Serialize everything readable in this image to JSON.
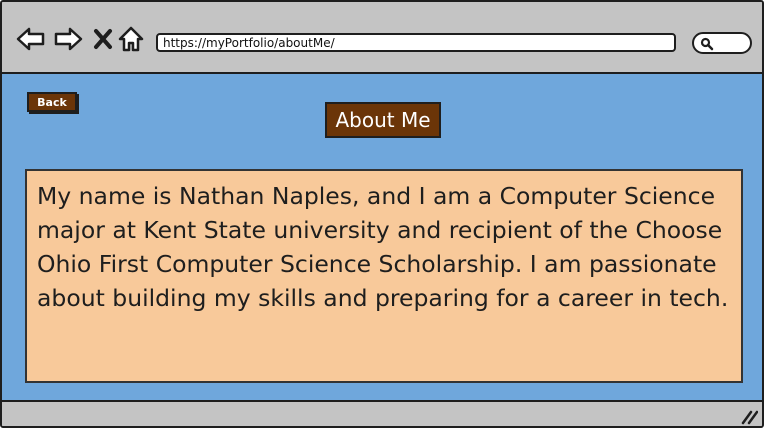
{
  "browser": {
    "url": "https://myPortfolio/aboutMe/",
    "icons": {
      "back": "arrow-left-icon",
      "forward": "arrow-right-icon",
      "stop": "close-icon",
      "home": "home-icon",
      "search": "search-icon",
      "resize": "resize-grip-icon"
    }
  },
  "page": {
    "back_label": "Back",
    "title": "About Me",
    "bio": "My name is Nathan Naples, and I am a Computer Science major at Kent State university and recipient of the Choose Ohio First Computer Science Scholarship. I am passionate about building my skills and preparing for a career in tech."
  },
  "colors": {
    "content_background": "#6fa7dc",
    "button_brown": "#6b3508",
    "panel_peach": "#f8c99a",
    "chrome_gray": "#c4c4c4"
  }
}
